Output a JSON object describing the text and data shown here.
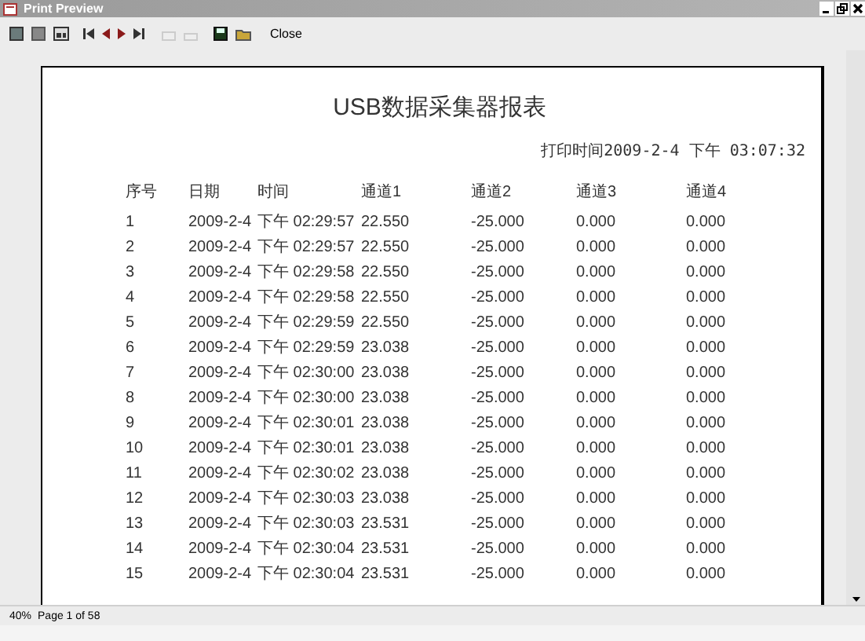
{
  "window": {
    "title": "Print Preview"
  },
  "toolbar": {
    "close_button": "Close"
  },
  "report": {
    "title": "USB数据采集器报表",
    "print_time": "打印时间2009-2-4 下午 03:07:32",
    "columns": [
      "序号",
      "日期",
      "时间",
      "通道1",
      "通道2",
      "通道3",
      "通道4"
    ],
    "rows": [
      [
        "1",
        "2009-2-4",
        "下午 02:29:57",
        "22.550",
        "-25.000",
        "0.000",
        "0.000"
      ],
      [
        "2",
        "2009-2-4",
        "下午 02:29:57",
        "22.550",
        "-25.000",
        "0.000",
        "0.000"
      ],
      [
        "3",
        "2009-2-4",
        "下午 02:29:58",
        "22.550",
        "-25.000",
        "0.000",
        "0.000"
      ],
      [
        "4",
        "2009-2-4",
        "下午 02:29:58",
        "22.550",
        "-25.000",
        "0.000",
        "0.000"
      ],
      [
        "5",
        "2009-2-4",
        "下午 02:29:59",
        "22.550",
        "-25.000",
        "0.000",
        "0.000"
      ],
      [
        "6",
        "2009-2-4",
        "下午 02:29:59",
        "23.038",
        "-25.000",
        "0.000",
        "0.000"
      ],
      [
        "7",
        "2009-2-4",
        "下午 02:30:00",
        "23.038",
        "-25.000",
        "0.000",
        "0.000"
      ],
      [
        "8",
        "2009-2-4",
        "下午 02:30:00",
        "23.038",
        "-25.000",
        "0.000",
        "0.000"
      ],
      [
        "9",
        "2009-2-4",
        "下午 02:30:01",
        "23.038",
        "-25.000",
        "0.000",
        "0.000"
      ],
      [
        "10",
        "2009-2-4",
        "下午 02:30:01",
        "23.038",
        "-25.000",
        "0.000",
        "0.000"
      ],
      [
        "11",
        "2009-2-4",
        "下午 02:30:02",
        "23.038",
        "-25.000",
        "0.000",
        "0.000"
      ],
      [
        "12",
        "2009-2-4",
        "下午 02:30:03",
        "23.038",
        "-25.000",
        "0.000",
        "0.000"
      ],
      [
        "13",
        "2009-2-4",
        "下午 02:30:03",
        "23.531",
        "-25.000",
        "0.000",
        "0.000"
      ],
      [
        "14",
        "2009-2-4",
        "下午 02:30:04",
        "23.531",
        "-25.000",
        "0.000",
        "0.000"
      ],
      [
        "15",
        "2009-2-4",
        "下午 02:30:04",
        "23.531",
        "-25.000",
        "0.000",
        "0.000"
      ]
    ]
  },
  "status_bar": {
    "zoom": "40%",
    "page": "Page 1 of 58"
  }
}
